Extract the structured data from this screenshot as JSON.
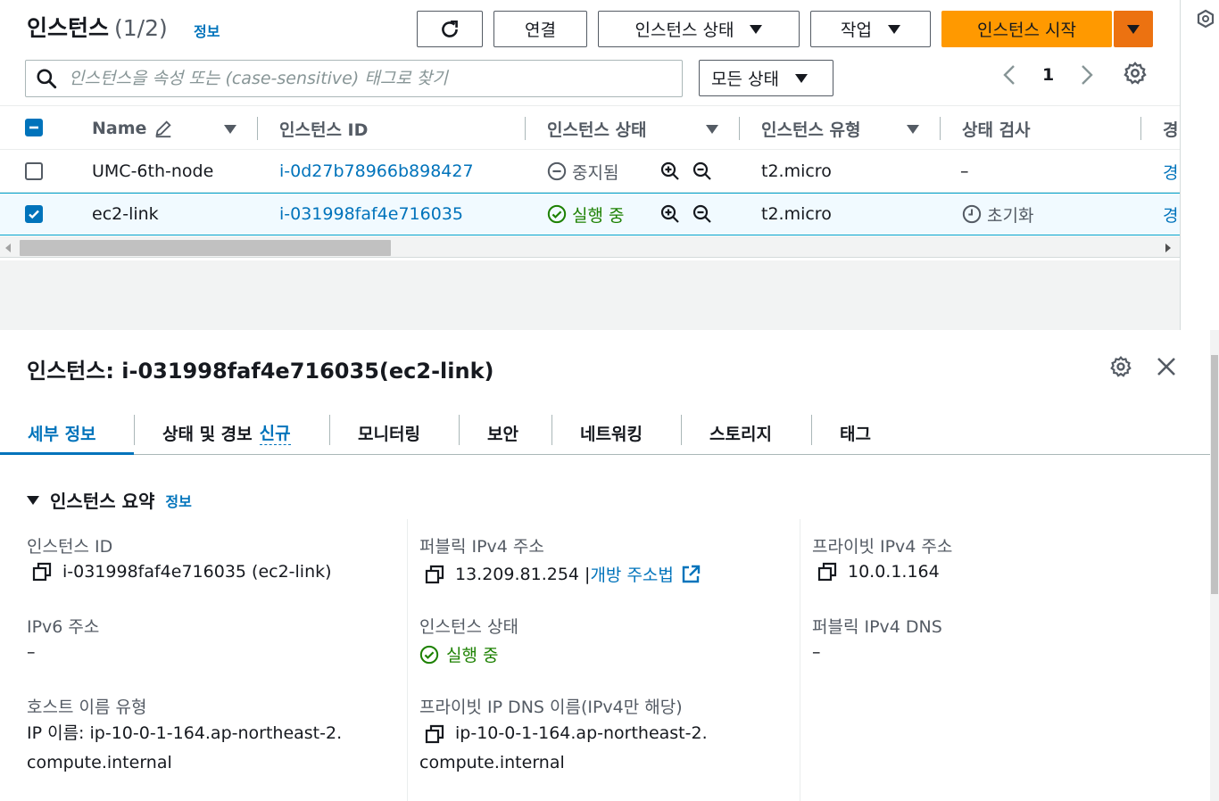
{
  "header": {
    "title": "인스턴스",
    "count": "(1/2)",
    "info": "정보",
    "buttons": {
      "connect": "연결",
      "instance_state": "인스턴스 상태",
      "actions": "작업",
      "start": "인스턴스 시작"
    },
    "search_placeholder": "인스턴스을 속성 또는 (case-sensitive) 태그로 찾기",
    "state_filter": "모든 상태",
    "page": "1"
  },
  "table": {
    "columns": [
      "Name",
      "인스턴스 ID",
      "인스턴스 상태",
      "인스턴스 유형",
      "상태 검사",
      "경"
    ],
    "rows": [
      {
        "name": "UMC-6th-node",
        "id": "i-0d27b78966b898427",
        "state": "중지됨",
        "type": "t2.micro",
        "check": "–",
        "alarm": "경",
        "selected": false
      },
      {
        "name": "ec2-link",
        "id": "i-031998faf4e716035",
        "state": "실행 중",
        "type": "t2.micro",
        "check": "초기화",
        "alarm": "경",
        "selected": true
      }
    ]
  },
  "detail": {
    "title": "인스턴스: i-031998faf4e716035(ec2-link)",
    "tabs": [
      "세부 정보",
      "상태 및 경보",
      "모니터링",
      "보안",
      "네트워킹",
      "스토리지",
      "태그"
    ],
    "tab_new": "신규",
    "section_title": "인스턴스 요약",
    "section_info": "정보",
    "fields": {
      "instance_id_label": "인스턴스 ID",
      "instance_id_value": "i-031998faf4e716035 (ec2-link)",
      "public_ipv4_label": "퍼블릭 IPv4 주소",
      "public_ipv4_value": "13.209.81.254 |",
      "public_ipv4_link": "개방 주소법",
      "private_ipv4_label": "프라이빗 IPv4 주소",
      "private_ipv4_value": "10.0.1.164",
      "ipv6_label": "IPv6 주소",
      "ipv6_value": "–",
      "instance_state_label": "인스턴스 상태",
      "instance_state_value": "실행 중",
      "public_dns_label": "퍼블릭 IPv4 DNS",
      "public_dns_value": "–",
      "hostname_type_label": "호스트 이름 유형",
      "hostname_type_value": "IP 이름: ip-10-0-1-164.ap-northeast-2.compute.internal",
      "private_dns_label": "프라이빗 IP DNS 이름(IPv4만 해당)",
      "private_dns_value": "ip-10-0-1-164.ap-northeast-2.compute.internal"
    }
  },
  "colors": {
    "link": "#0073bb",
    "primary": "#ff9900",
    "success": "#1d8102",
    "border": "#aab7b8"
  }
}
